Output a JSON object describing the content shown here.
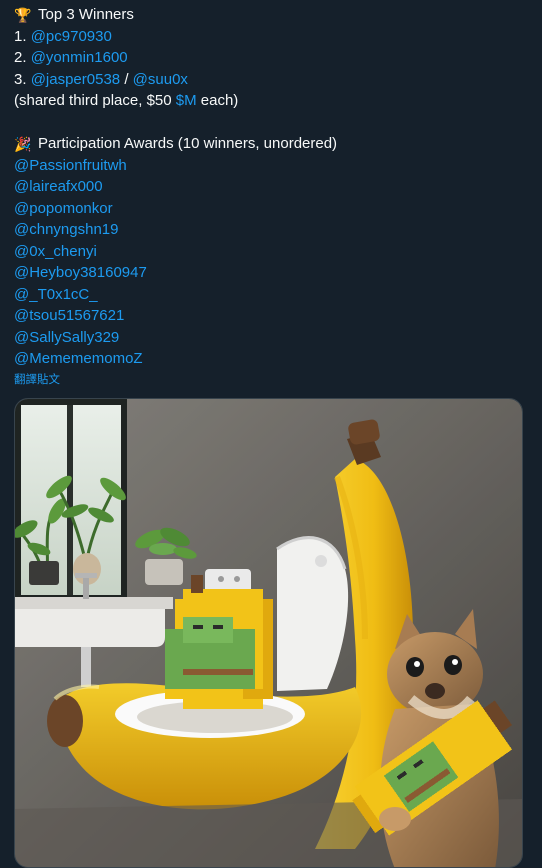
{
  "post": {
    "top3": {
      "icon": "trophy-icon",
      "heading": "Top 3 Winners",
      "first": {
        "rank": "1.",
        "handle": "@pc970930"
      },
      "second": {
        "rank": "2.",
        "handle": "@yonmin1600"
      },
      "third": {
        "rank": "3.",
        "handle_a": "@jasper0538",
        "separator": "/",
        "handle_b": "@suu0x"
      },
      "note_prefix": "(shared third place, $50 ",
      "note_cashtag": "$M",
      "note_suffix": " each)"
    },
    "participation": {
      "icon": "party-popper-icon",
      "heading": "Participation Awards (10 winners, unordered)",
      "winners": [
        "@Passionfruitwh",
        "@laireafx000",
        "@popomonkor",
        "@chnyngshn19",
        "@0x_chenyi",
        "@Heyboy38160947",
        "@_T0x1cC_",
        "@tsou51567621",
        "@SallySally329",
        "@MemememomoZ"
      ]
    },
    "translate_label": "翻譯貼文"
  },
  "media": {
    "alt": "banana-toilet-cat-image"
  },
  "colors": {
    "background": "#15202b",
    "text": "#f7f9f9",
    "link": "#1d9bf0",
    "banana": "#f2c318",
    "pixel_pepe": "#6aa84f"
  }
}
